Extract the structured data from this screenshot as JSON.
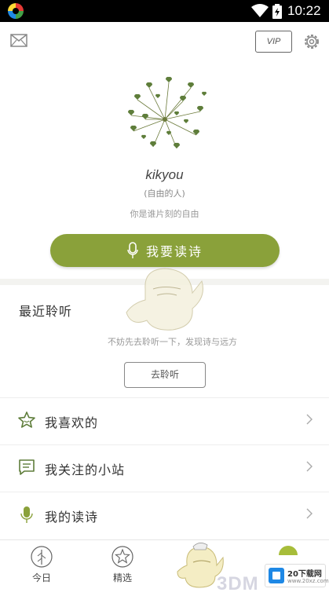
{
  "status_bar": {
    "time": "10:22"
  },
  "header": {
    "vip_label": "VIP"
  },
  "profile": {
    "username": "kikyou",
    "tag": "(自由的人)",
    "bio": "你是谁片刻的自由",
    "recite_button_label": "我要读诗"
  },
  "recent": {
    "title": "最近聆听",
    "empty_hint": "不妨先去聆听一下，发现诗与远方",
    "go_listen_label": "去聆听"
  },
  "menu": {
    "items": [
      {
        "label": "我喜欢的",
        "icon": "star-icon"
      },
      {
        "label": "我关注的小站",
        "icon": "chat-icon"
      },
      {
        "label": "我的读诗",
        "icon": "mic-icon"
      }
    ]
  },
  "bottom_nav": {
    "items": [
      {
        "label": "今日",
        "icon": "tree-icon"
      },
      {
        "label": "精选",
        "icon": "star-icon"
      }
    ]
  },
  "watermark": {
    "text": "3DM",
    "site_name": "20下载网",
    "site_url": "www.20xz.com"
  },
  "colors": {
    "accent": "#8aa13a",
    "status_bar": "#000000",
    "divider": "#f3f3f0"
  }
}
